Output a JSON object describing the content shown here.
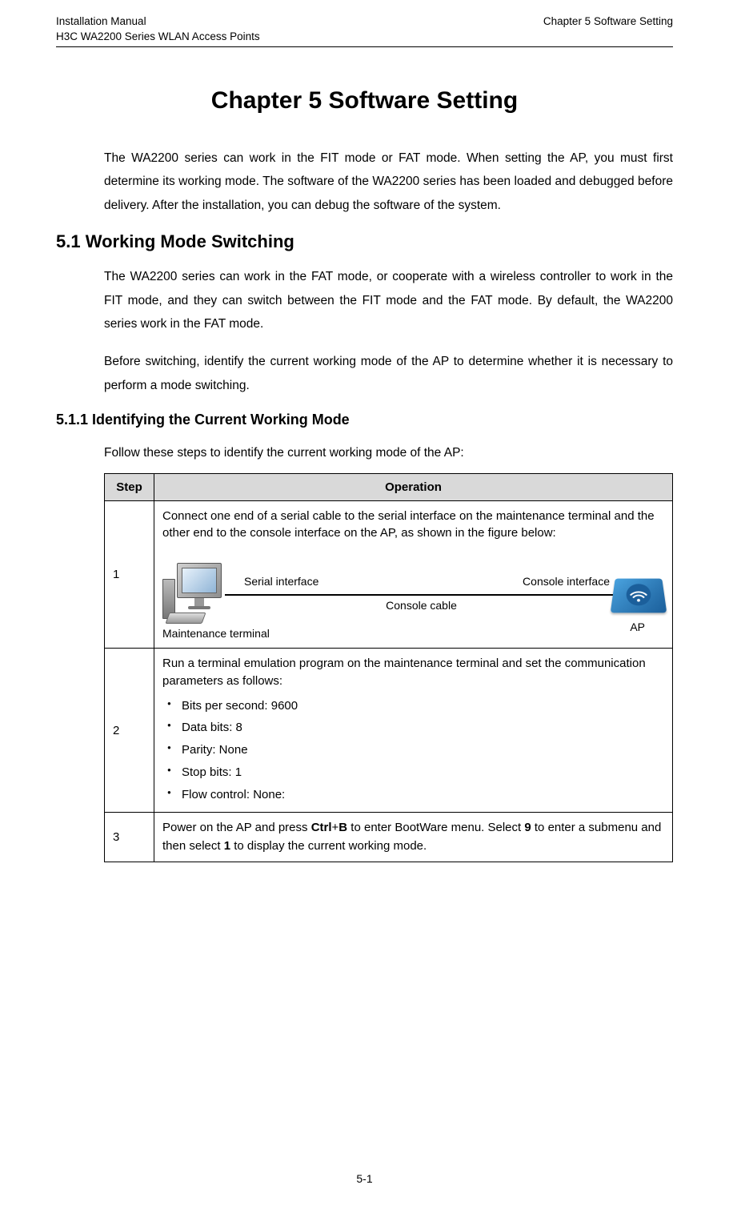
{
  "header": {
    "left_line1": "Installation Manual",
    "left_line2": "H3C WA2200 Series WLAN Access Points",
    "right_line1": "",
    "right_line2": "Chapter 5  Software Setting"
  },
  "chapter_title": "Chapter 5  Software Setting",
  "intro_paragraph": "The WA2200 series can work in the FIT mode or FAT mode. When setting the AP, you must first determine its working mode. The software of the WA2200 series has been loaded and debugged before delivery. After the installation, you can debug the software of the system.",
  "section_5_1": {
    "heading": "5.1  Working Mode Switching",
    "p1": "The WA2200 series can work in the FAT mode, or cooperate with a wireless controller to work in the FIT mode, and they can switch between the FIT mode and the FAT mode. By default, the WA2200 series work in the FAT mode.",
    "p2": "Before switching, identify the current working mode of the AP to determine whether it is necessary to perform a mode switching."
  },
  "section_5_1_1": {
    "heading": "5.1.1  Identifying the Current Working Mode",
    "intro": "Follow these steps to identify the current working mode of the AP:",
    "table": {
      "col_step": "Step",
      "col_operation": "Operation",
      "rows": [
        {
          "step": "1",
          "intro": "Connect one end of a serial cable to the serial interface on the maintenance terminal and the other end to the console interface on the AP, as shown in the figure below:",
          "diagram": {
            "serial_interface": "Serial interface",
            "console_interface": "Console interface",
            "console_cable": "Console cable",
            "maintenance_terminal": "Maintenance terminal",
            "ap": "AP"
          }
        },
        {
          "step": "2",
          "intro": "Run a terminal emulation program on the maintenance terminal and set the communication parameters as follows:",
          "bullets": [
            "Bits per second: 9600",
            "Data bits: 8",
            "Parity: None",
            "Stop bits: 1",
            "Flow control: None:"
          ]
        },
        {
          "step": "3",
          "text_parts": {
            "p1": "Power on the AP and press ",
            "ctrl": "Ctrl",
            "plus": "+",
            "b": "B",
            "p2": " to enter BootWare menu. Select ",
            "nine": "9",
            "p3": " to enter a submenu and then select ",
            "one": "1",
            "p4": " to display the current working mode."
          }
        }
      ]
    }
  },
  "footer": {
    "page_number": "5-1"
  }
}
